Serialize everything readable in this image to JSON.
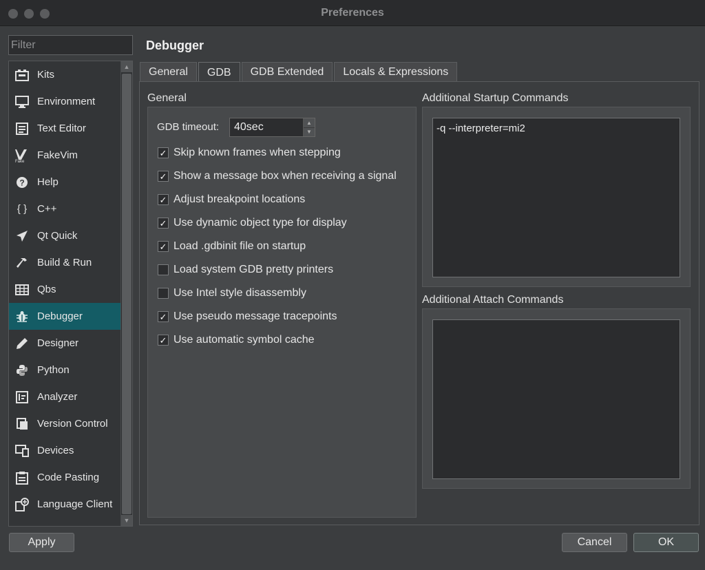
{
  "window": {
    "title": "Preferences"
  },
  "filter": {
    "placeholder": "Filter"
  },
  "sidebar": {
    "items": [
      {
        "label": "Kits",
        "icon": "kits-icon"
      },
      {
        "label": "Environment",
        "icon": "monitor-icon"
      },
      {
        "label": "Text Editor",
        "icon": "text-editor-icon"
      },
      {
        "label": "FakeVim",
        "icon": "fakevim-icon"
      },
      {
        "label": "Help",
        "icon": "help-icon"
      },
      {
        "label": "C++",
        "icon": "braces-icon"
      },
      {
        "label": "Qt Quick",
        "icon": "paper-plane-icon"
      },
      {
        "label": "Build & Run",
        "icon": "hammer-icon"
      },
      {
        "label": "Qbs",
        "icon": "qbs-icon"
      },
      {
        "label": "Debugger",
        "icon": "bug-icon",
        "active": true
      },
      {
        "label": "Designer",
        "icon": "pencil-icon"
      },
      {
        "label": "Python",
        "icon": "python-icon"
      },
      {
        "label": "Analyzer",
        "icon": "analyzer-icon"
      },
      {
        "label": "Version Control",
        "icon": "version-control-icon"
      },
      {
        "label": "Devices",
        "icon": "devices-icon"
      },
      {
        "label": "Code Pasting",
        "icon": "clipboard-icon"
      },
      {
        "label": "Language Client",
        "icon": "language-client-icon"
      }
    ]
  },
  "page": {
    "title": "Debugger"
  },
  "tabs": [
    "General",
    "GDB",
    "GDB Extended",
    "Locals & Expressions"
  ],
  "active_tab": "GDB",
  "general_group": {
    "title": "General",
    "timeout_label": "GDB timeout:",
    "timeout_value": "40sec",
    "checks": [
      {
        "label": "Skip known frames when stepping",
        "checked": true
      },
      {
        "label": "Show a message box when receiving a signal",
        "checked": true
      },
      {
        "label": "Adjust breakpoint locations",
        "checked": true
      },
      {
        "label": "Use dynamic object type for display",
        "checked": true
      },
      {
        "label": "Load .gdbinit file on startup",
        "checked": true
      },
      {
        "label": "Load system GDB pretty printers",
        "checked": false
      },
      {
        "label": "Use Intel style disassembly",
        "checked": false
      },
      {
        "label": "Use pseudo message tracepoints",
        "checked": true
      },
      {
        "label": "Use automatic symbol cache",
        "checked": true
      }
    ]
  },
  "startup_group": {
    "title": "Additional Startup Commands",
    "value": "-q --interpreter=mi2"
  },
  "attach_group": {
    "title": "Additional Attach Commands",
    "value": ""
  },
  "buttons": {
    "apply": "Apply",
    "cancel": "Cancel",
    "ok": "OK"
  },
  "colors": {
    "accent": "#145c65",
    "window_bg": "#3b3d3f",
    "group_bg": "#47494b"
  }
}
